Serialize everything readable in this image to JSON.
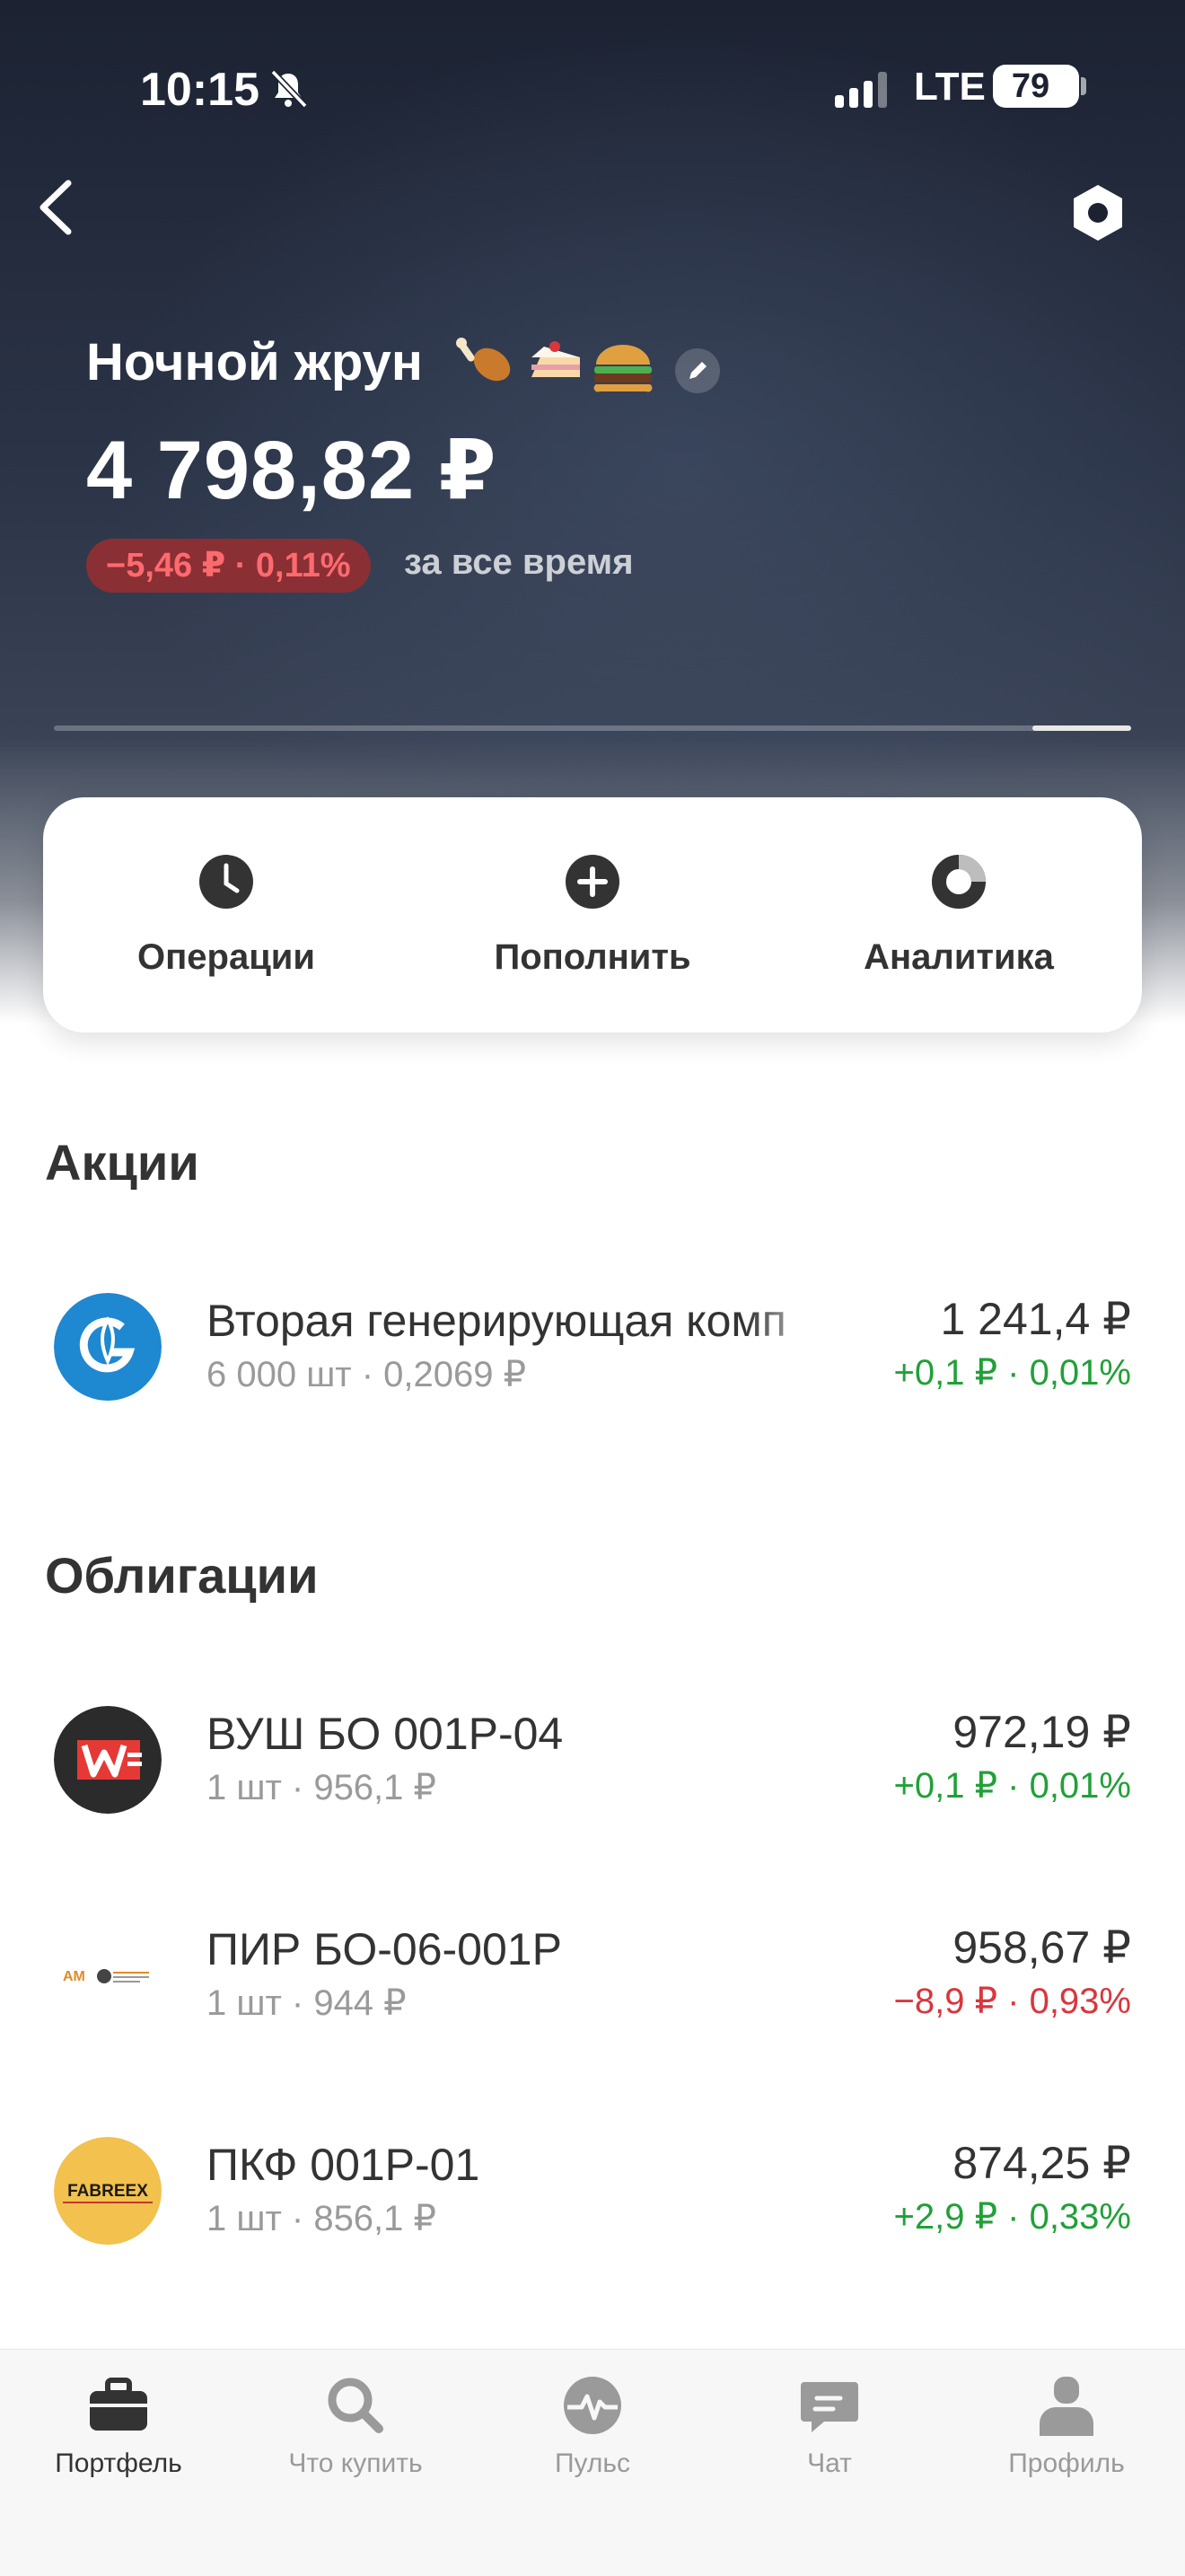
{
  "status_bar": {
    "time": "10:15",
    "network": "LTE",
    "battery": "79"
  },
  "portfolio": {
    "name": "Ночной жрун",
    "emoji": "🍗🍰🍔",
    "total": "4 798,82 ₽",
    "change": "−5,46 ₽ · 0,11%",
    "change_period": "за все время",
    "change_color": "#d9363e"
  },
  "actions": [
    {
      "label": "Операции",
      "icon": "clock-icon"
    },
    {
      "label": "Пополнить",
      "icon": "plus-circle-icon"
    },
    {
      "label": "Аналитика",
      "icon": "donut-chart-icon"
    }
  ],
  "sections": {
    "stocks_title": "Акции",
    "bonds_title": "Облигации"
  },
  "stocks": [
    {
      "name": "Вторая генерирующая комп",
      "sub": "6 000 шт · 0,2069 ₽",
      "value": "1 241,4 ₽",
      "delta": "+0,1 ₽ · 0,01%",
      "trend": "up"
    }
  ],
  "bonds": [
    {
      "name": "ВУШ БО 001Р-04",
      "sub": "1 шт · 956,1 ₽",
      "value": "972,19 ₽",
      "delta": "+0,1 ₽ · 0,01%",
      "trend": "up"
    },
    {
      "name": "ПИР БО-06-001Р",
      "sub": "1 шт · 944 ₽",
      "value": "958,67 ₽",
      "delta": "−8,9 ₽ · 0,93%",
      "trend": "down"
    },
    {
      "name": "ПКФ 001Р-01",
      "sub": "1 шт · 856,1 ₽",
      "value": "874,25 ₽",
      "delta": "+2,9 ₽ · 0,33%",
      "trend": "up",
      "logo_text": "FABREEX"
    }
  ],
  "tabs": [
    {
      "label": "Портфель",
      "icon": "briefcase-icon",
      "active": true
    },
    {
      "label": "Что купить",
      "icon": "search-icon"
    },
    {
      "label": "Пульс",
      "icon": "pulse-icon"
    },
    {
      "label": "Чат",
      "icon": "chat-icon"
    },
    {
      "label": "Профиль",
      "icon": "profile-icon"
    }
  ],
  "colors": {
    "positive": "#21a038",
    "negative": "#d9363e",
    "header_bg": "#1c2232"
  }
}
